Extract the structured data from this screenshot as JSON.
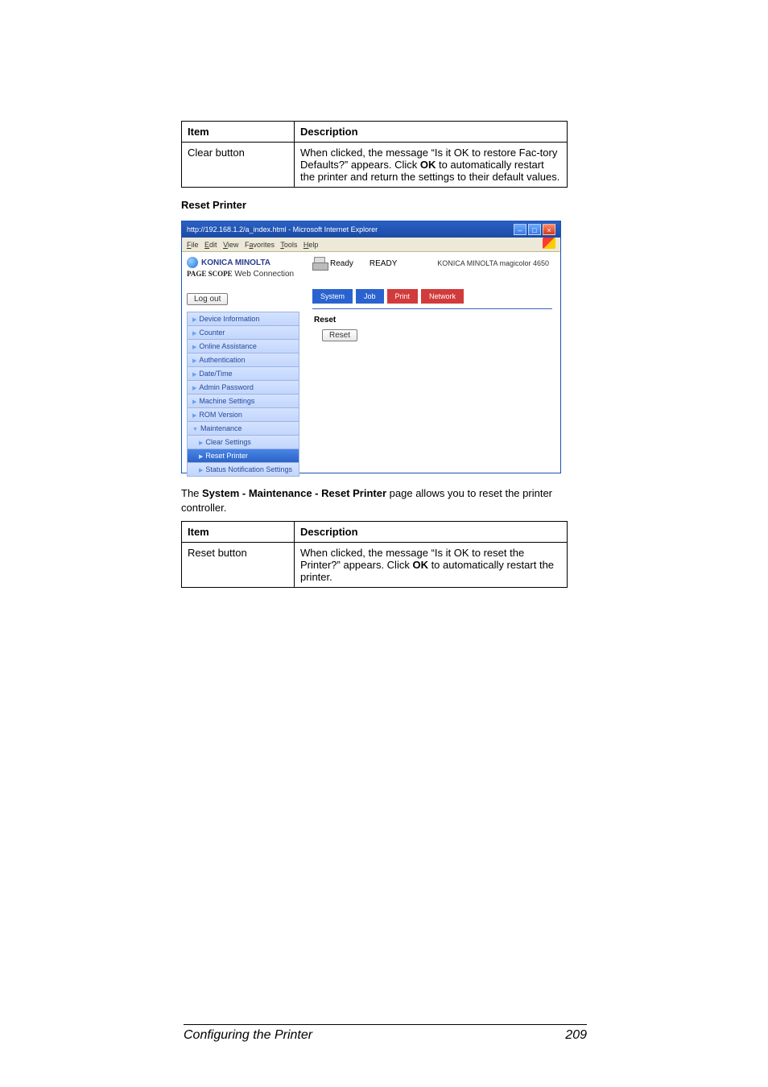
{
  "table1": {
    "h1": "Item",
    "h2": "Description",
    "r1c1": "Clear button",
    "r1c2_a": "When clicked, the message “Is it OK to restore Fac-",
    "r1c2_b": "tory Defaults?” appears. Click ",
    "r1c2_ok": "OK",
    "r1c2_c": " to automatically restart the printer and return the settings to their default values."
  },
  "subheading": "Reset Printer",
  "mock": {
    "title": "http://192.168.1.2/a_index.html - Microsoft Internet Explorer",
    "menu": {
      "file": "File",
      "edit": "Edit",
      "view": "View",
      "favorites": "Favorites",
      "tools": "Tools",
      "help": "Help"
    },
    "brand": "KONICA MINOLTA",
    "webconn_prefix": "PAGE SCOPE",
    "webconn_label": " Web Connection",
    "ready_small": "Ready",
    "ready_big": "READY",
    "product": "KONICA MINOLTA magicolor 4650",
    "logout": "Log out",
    "tabs": {
      "system": "System",
      "job": "Job",
      "print": "Print",
      "network": "Network"
    },
    "sidebar": [
      "Device Information",
      "Counter",
      "Online Assistance",
      "Authentication",
      "Date/Time",
      "Admin Password",
      "Machine Settings",
      "ROM Version",
      "Maintenance",
      "Clear Settings",
      "Reset Printer",
      "Status Notification Settings"
    ],
    "panel_title": "Reset",
    "reset_btn": "Reset"
  },
  "paragraph": {
    "a": "The ",
    "b": "System - Maintenance - Reset Printer",
    "c": " page allows you to reset the printer controller."
  },
  "table2": {
    "h1": "Item",
    "h2": "Description",
    "r1c1": "Reset button",
    "r1c2_a": "When clicked, the message “Is it OK to reset the Printer?” appears. Click ",
    "r1c2_ok": "OK",
    "r1c2_b": " to automatically restart the printer."
  },
  "footer": {
    "title": "Configuring the Printer",
    "page": "209"
  }
}
